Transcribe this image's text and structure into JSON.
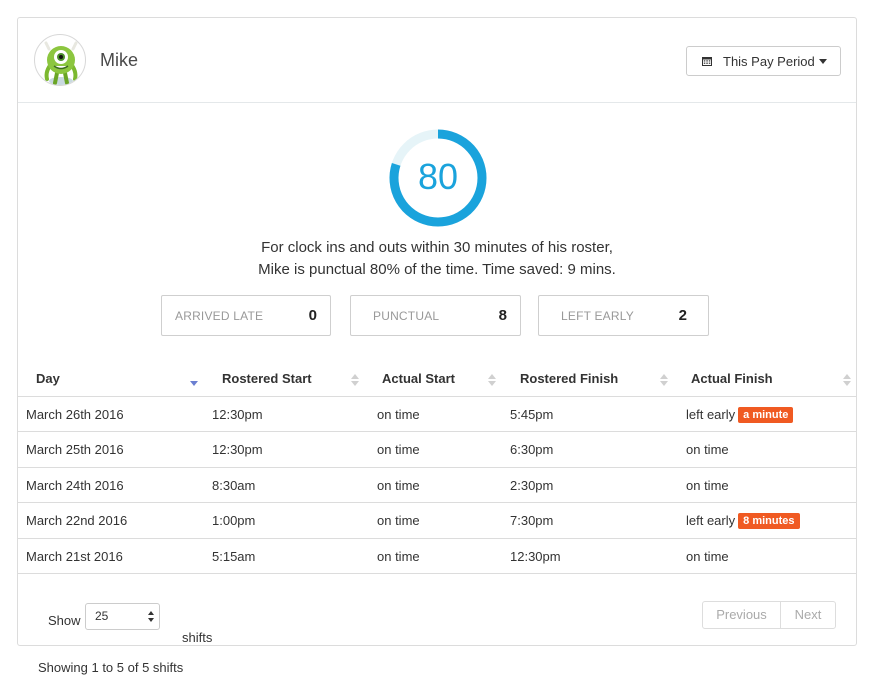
{
  "user": {
    "name": "Mike",
    "avatar_icon": "monster-avatar-icon"
  },
  "period_button": {
    "label": "This Pay Period",
    "icon": "calendar-icon"
  },
  "gauge": {
    "value": "80",
    "fill_percent": 80,
    "color": "#1aa3dc",
    "track_color": "#e6f4f8"
  },
  "summary": {
    "line1": "For clock ins and outs within 30 minutes of his roster,",
    "line2": "Mike is punctual 80% of the time. Time saved: 9 mins."
  },
  "stats": [
    {
      "label": "ARRIVED LATE",
      "value": "0"
    },
    {
      "label": "PUNCTUAL",
      "value": "8"
    },
    {
      "label": "LEFT EARLY",
      "value": "2"
    }
  ],
  "table": {
    "headers": [
      "Day",
      "Rostered Start",
      "Actual Start",
      "Rostered Finish",
      "Actual Finish"
    ],
    "rows": [
      {
        "day": "March 26th 2016",
        "rostered_start": "12:30pm",
        "actual_start": "on time",
        "rostered_finish": "5:45pm",
        "actual_finish": "left early",
        "badge": "a minute"
      },
      {
        "day": "March 25th 2016",
        "rostered_start": "12:30pm",
        "actual_start": "on time",
        "rostered_finish": "6:30pm",
        "actual_finish": "on time",
        "badge": ""
      },
      {
        "day": "March 24th 2016",
        "rostered_start": "8:30am",
        "actual_start": "on time",
        "rostered_finish": "2:30pm",
        "actual_finish": "on time",
        "badge": ""
      },
      {
        "day": "March 22nd 2016",
        "rostered_start": "1:00pm",
        "actual_start": "on time",
        "rostered_finish": "7:30pm",
        "actual_finish": "left early",
        "badge": "8 minutes"
      },
      {
        "day": "March 21st 2016",
        "rostered_start": "5:15am",
        "actual_start": "on time",
        "rostered_finish": "12:30pm",
        "actual_finish": "on time",
        "badge": ""
      }
    ]
  },
  "length_menu": {
    "show_label": "Show",
    "value": "25",
    "suffix": "shifts"
  },
  "pagination": {
    "previous": "Previous",
    "next": "Next"
  },
  "info": "Showing 1 to 5 of 5 shifts",
  "colors": {
    "badge": "#f05a22",
    "accent": "#1aa3dc",
    "sort_active": "#6b7fd1"
  }
}
